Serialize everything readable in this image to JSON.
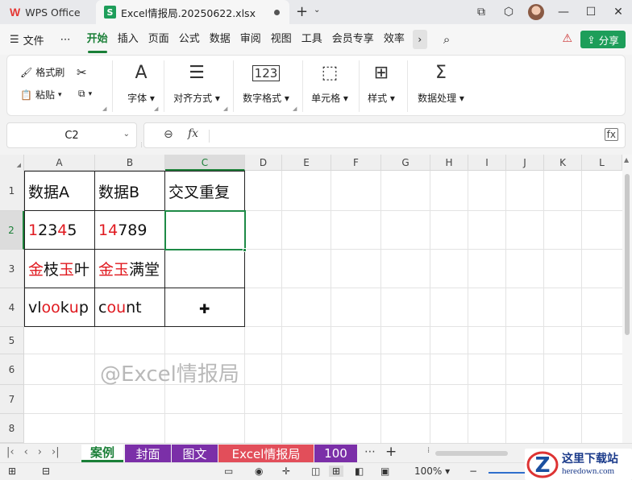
{
  "titlebar": {
    "home_label": "WPS Office",
    "file_tab": "Excel情报局.20250622.xlsx"
  },
  "menubar": {
    "file_label": "文件",
    "more_label": "⋯",
    "items": [
      "开始",
      "插入",
      "页面",
      "公式",
      "数据",
      "审阅",
      "视图",
      "工具",
      "会员专享",
      "效率"
    ],
    "active_item": "开始",
    "share_label": "分享"
  },
  "ribbon": {
    "format_painter": "格式刷",
    "paste": "粘贴",
    "font": "字体",
    "alignment": "对齐方式",
    "number_format": "数字格式",
    "cells": "单元格",
    "styles": "样式",
    "data_processing": "数据处理"
  },
  "formula_bar": {
    "name_box": "C2",
    "fx_label": "fx",
    "formula": ""
  },
  "grid": {
    "columns": [
      "A",
      "B",
      "C",
      "D",
      "E",
      "F",
      "G",
      "H",
      "I",
      "J",
      "K",
      "L"
    ],
    "selected_column": "C",
    "rows": [
      "1",
      "2",
      "3",
      "4",
      "5",
      "6",
      "7",
      "8"
    ],
    "selected_row": "2",
    "headers": {
      "a1": "数据A",
      "b1": "数据B",
      "c1": "交叉重复"
    },
    "a2": [
      {
        "t": "1",
        "red": true
      },
      {
        "t": "2",
        "red": false
      },
      {
        "t": "3",
        "red": false
      },
      {
        "t": "4",
        "red": true
      },
      {
        "t": "5",
        "red": false
      }
    ],
    "b2": [
      {
        "t": "14",
        "red": true
      },
      {
        "t": "789",
        "red": false
      }
    ],
    "a3": [
      {
        "t": "金",
        "red": true
      },
      {
        "t": "枝",
        "red": false
      },
      {
        "t": "玉",
        "red": true
      },
      {
        "t": "叶",
        "red": false
      }
    ],
    "b3": [
      {
        "t": "金玉",
        "red": true
      },
      {
        "t": "满堂",
        "red": false
      }
    ],
    "a4": [
      {
        "t": "vl",
        "red": false
      },
      {
        "t": "oo",
        "red": true
      },
      {
        "t": "k",
        "red": false
      },
      {
        "t": "u",
        "red": true
      },
      {
        "t": "p",
        "red": false
      }
    ],
    "b4": [
      {
        "t": "c",
        "red": false
      },
      {
        "t": "ou",
        "red": true
      },
      {
        "t": "nt",
        "red": false
      }
    ],
    "watermark": "@Excel情报局"
  },
  "sheets": [
    {
      "label": "案例",
      "color": "#ffffff",
      "active": true
    },
    {
      "label": "封面",
      "color": "#7b2fa8",
      "active": false
    },
    {
      "label": "图文",
      "color": "#7b2fa8",
      "active": false
    },
    {
      "label": "Excel情报局",
      "color": "#e24e5a",
      "active": false
    },
    {
      "label": "100",
      "color": "#7b2fa8",
      "active": false
    }
  ],
  "statusbar": {
    "zoom": "100%"
  },
  "site_logo": {
    "cn": "这里下载站",
    "en": "heredown.com"
  },
  "colors": {
    "accent_green": "#1a7f37",
    "highlight_red": "#e0191f",
    "share_green": "#1e9e5a"
  }
}
